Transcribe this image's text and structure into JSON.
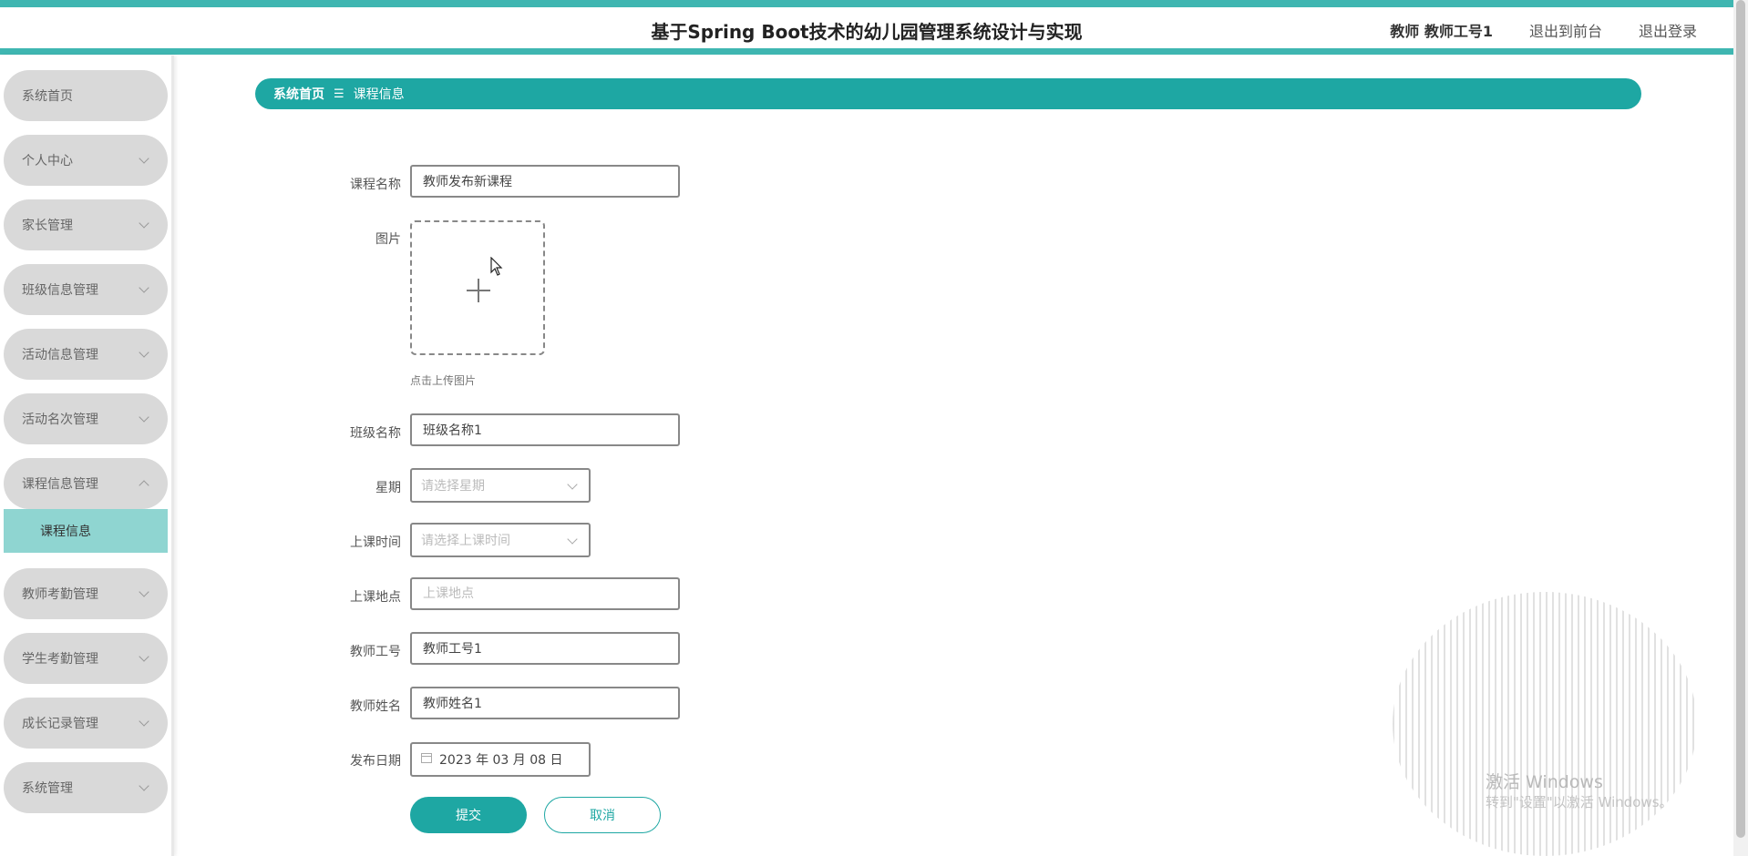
{
  "header": {
    "title": "基于Spring Boot技术的幼儿园管理系统设计与实现",
    "user": "教师 教师工号1",
    "to_front": "退出到前台",
    "logout": "退出登录"
  },
  "sidebar": {
    "items": [
      {
        "label": "系统首页"
      },
      {
        "label": "个人中心"
      },
      {
        "label": "家长管理"
      },
      {
        "label": "班级信息管理"
      },
      {
        "label": "活动信息管理"
      },
      {
        "label": "活动名次管理"
      },
      {
        "label": "课程信息管理"
      },
      {
        "label": "教师考勤管理"
      },
      {
        "label": "学生考勤管理"
      },
      {
        "label": "成长记录管理"
      },
      {
        "label": "系统管理"
      }
    ],
    "active_sub": "课程信息"
  },
  "breadcrumb": {
    "home": "系统首页",
    "separator": "☰",
    "current": "课程信息"
  },
  "form": {
    "course_name": {
      "label": "课程名称",
      "value": "教师发布新课程"
    },
    "image": {
      "label": "图片",
      "hint": "点击上传图片"
    },
    "class_name": {
      "label": "班级名称",
      "value": "班级名称1"
    },
    "weekday": {
      "label": "星期",
      "placeholder": "请选择星期"
    },
    "class_time": {
      "label": "上课时间",
      "placeholder": "请选择上课时间"
    },
    "location": {
      "label": "上课地点",
      "placeholder": "上课地点",
      "value": ""
    },
    "teacher_id": {
      "label": "教师工号",
      "value": "教师工号1"
    },
    "teacher_name": {
      "label": "教师姓名",
      "value": "教师姓名1"
    },
    "publish_date": {
      "label": "发布日期",
      "value": "2023 年 03 月 08 日"
    },
    "submit": "提交",
    "cancel": "取消"
  },
  "watermark": {
    "line1": "激活 Windows",
    "line2": "转到\"设置\"以激活 Windows。"
  },
  "colors": {
    "accent": "#1ea7a3",
    "accent_light": "#8fd5d1",
    "menu_bg": "#d9d9d9"
  }
}
